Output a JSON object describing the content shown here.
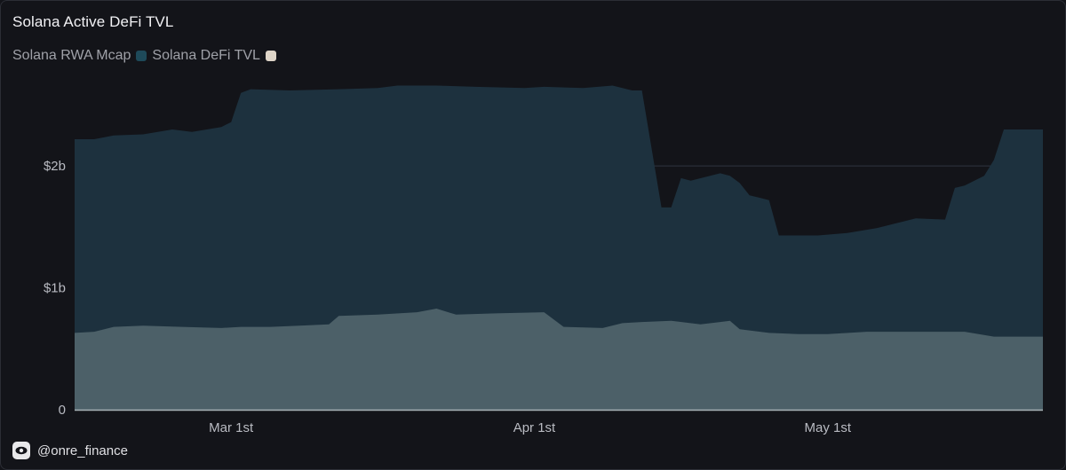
{
  "title": "Solana Active DeFi TVL",
  "legend": [
    {
      "label": "Solana RWA Mcap",
      "color": "#1e4a5a"
    },
    {
      "label": "Solana DeFi TVL",
      "color": "#ded5c8"
    }
  ],
  "footer": {
    "handle": "@onre_finance",
    "icon": "eye-icon"
  },
  "colors": {
    "tvl_area": "#1d313e",
    "rwa_area": "#4c6068",
    "grid": "#2f3440",
    "axis": "#a9b3b8"
  },
  "chart_data": {
    "type": "area",
    "stacked": true,
    "grid": true,
    "ylim": [
      0,
      2.7
    ],
    "y_unit": "billion USD",
    "yticks": [
      {
        "value": 0,
        "label": "0"
      },
      {
        "value": 1,
        "label": "$1b"
      },
      {
        "value": 2,
        "label": "$2b"
      }
    ],
    "x_start": "2025-02-13",
    "x_end": "2025-05-23",
    "xticks": [
      {
        "x": "2025-03-01",
        "label": "Mar 1st"
      },
      {
        "x": "2025-04-01",
        "label": "Apr 1st"
      },
      {
        "x": "2025-05-01",
        "label": "May 1st"
      }
    ],
    "series": [
      {
        "name": "Solana RWA Mcap",
        "points": [
          [
            "2025-02-13",
            0.63
          ],
          [
            "2025-02-15",
            0.64
          ],
          [
            "2025-02-17",
            0.68
          ],
          [
            "2025-02-20",
            0.69
          ],
          [
            "2025-02-24",
            0.68
          ],
          [
            "2025-02-28",
            0.67
          ],
          [
            "2025-03-02",
            0.68
          ],
          [
            "2025-03-05",
            0.68
          ],
          [
            "2025-03-08",
            0.69
          ],
          [
            "2025-03-11",
            0.7
          ],
          [
            "2025-03-12",
            0.77
          ],
          [
            "2025-03-16",
            0.78
          ],
          [
            "2025-03-20",
            0.8
          ],
          [
            "2025-03-22",
            0.83
          ],
          [
            "2025-03-24",
            0.78
          ],
          [
            "2025-03-28",
            0.79
          ],
          [
            "2025-04-02",
            0.8
          ],
          [
            "2025-04-04",
            0.68
          ],
          [
            "2025-04-08",
            0.67
          ],
          [
            "2025-04-10",
            0.71
          ],
          [
            "2025-04-12",
            0.72
          ],
          [
            "2025-04-15",
            0.73
          ],
          [
            "2025-04-18",
            0.7
          ],
          [
            "2025-04-20",
            0.72
          ],
          [
            "2025-04-21",
            0.73
          ],
          [
            "2025-04-22",
            0.66
          ],
          [
            "2025-04-25",
            0.63
          ],
          [
            "2025-04-28",
            0.62
          ],
          [
            "2025-05-01",
            0.62
          ],
          [
            "2025-05-05",
            0.64
          ],
          [
            "2025-05-10",
            0.64
          ],
          [
            "2025-05-15",
            0.64
          ],
          [
            "2025-05-18",
            0.6
          ],
          [
            "2025-05-23",
            0.6
          ]
        ]
      },
      {
        "name": "Solana DeFi TVL",
        "points": [
          [
            "2025-02-13",
            2.22
          ],
          [
            "2025-02-15",
            2.22
          ],
          [
            "2025-02-17",
            2.25
          ],
          [
            "2025-02-20",
            2.26
          ],
          [
            "2025-02-23",
            2.3
          ],
          [
            "2025-02-25",
            2.28
          ],
          [
            "2025-02-28",
            2.32
          ],
          [
            "2025-03-01",
            2.36
          ],
          [
            "2025-03-02",
            2.6
          ],
          [
            "2025-03-03",
            2.63
          ],
          [
            "2025-03-07",
            2.62
          ],
          [
            "2025-03-12",
            2.63
          ],
          [
            "2025-03-16",
            2.64
          ],
          [
            "2025-03-18",
            2.66
          ],
          [
            "2025-03-22",
            2.66
          ],
          [
            "2025-03-26",
            2.65
          ],
          [
            "2025-03-31",
            2.64
          ],
          [
            "2025-04-02",
            2.65
          ],
          [
            "2025-04-06",
            2.64
          ],
          [
            "2025-04-09",
            2.66
          ],
          [
            "2025-04-11",
            2.62
          ],
          [
            "2025-04-12",
            2.62
          ],
          [
            "2025-04-14",
            1.66
          ],
          [
            "2025-04-15",
            1.66
          ],
          [
            "2025-04-16",
            1.9
          ],
          [
            "2025-04-17",
            1.88
          ],
          [
            "2025-04-20",
            1.94
          ],
          [
            "2025-04-21",
            1.92
          ],
          [
            "2025-04-22",
            1.86
          ],
          [
            "2025-04-23",
            1.76
          ],
          [
            "2025-04-24",
            1.74
          ],
          [
            "2025-04-25",
            1.72
          ],
          [
            "2025-04-26",
            1.43
          ],
          [
            "2025-04-30",
            1.43
          ],
          [
            "2025-05-03",
            1.45
          ],
          [
            "2025-05-06",
            1.49
          ],
          [
            "2025-05-08",
            1.53
          ],
          [
            "2025-05-10",
            1.57
          ],
          [
            "2025-05-13",
            1.56
          ],
          [
            "2025-05-14",
            1.82
          ],
          [
            "2025-05-15",
            1.84
          ],
          [
            "2025-05-17",
            1.92
          ],
          [
            "2025-05-18",
            2.05
          ],
          [
            "2025-05-19",
            2.3
          ],
          [
            "2025-05-23",
            2.3
          ]
        ]
      }
    ]
  }
}
